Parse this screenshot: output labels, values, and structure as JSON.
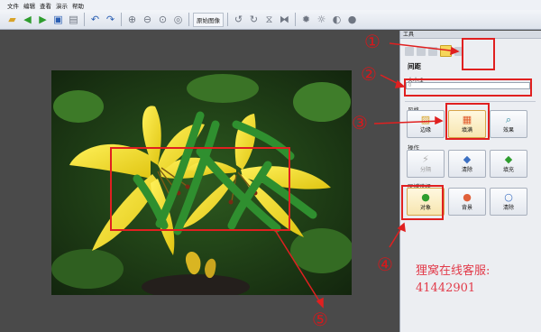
{
  "menu": [
    "文件",
    "编辑",
    "查看",
    "演示",
    "帮助"
  ],
  "toolbar": {
    "icons": [
      "folder-open-icon",
      "back-arrow-icon",
      "forward-arrow-icon",
      "save-icon",
      "print-icon",
      "undo-icon",
      "redo-icon",
      "zoom-in-icon",
      "zoom-out-icon",
      "zoom-fit-icon",
      "zoom-actual-icon"
    ],
    "original_image_label": "原始图像",
    "tool_icons": [
      "rotate-left-icon",
      "rotate-right-icon",
      "flip-vertical-icon",
      "flip-horizontal-icon",
      "gear-icon",
      "sun-icon",
      "contrast-icon",
      "brightness-icon"
    ]
  },
  "panel": {
    "title": "工具",
    "tool_modes": [
      "mode-1",
      "mode-2",
      "mode-3",
      "mode-fill-active",
      "mode-5"
    ],
    "spacing_title": "间距",
    "size_label": "大小:2",
    "size_value": "0",
    "style_title": "风格",
    "style_buttons": [
      "边缘",
      "填满",
      "效果"
    ],
    "operation_title": "操作",
    "operation_buttons": [
      "分隔",
      "清除",
      "填充"
    ],
    "region_title": "区域选择",
    "region_buttons": [
      "对象",
      "背景",
      "清除"
    ]
  },
  "annotations": {
    "markers": [
      "①",
      "②",
      "③",
      "④",
      "⑤"
    ],
    "note_line1": "狸窝在线客服:",
    "note_line2": "41442901"
  },
  "colors": {
    "annotation_red": "#e02020",
    "stroke_green": "#2f8f2f",
    "panel_bg": "#eceef2"
  }
}
